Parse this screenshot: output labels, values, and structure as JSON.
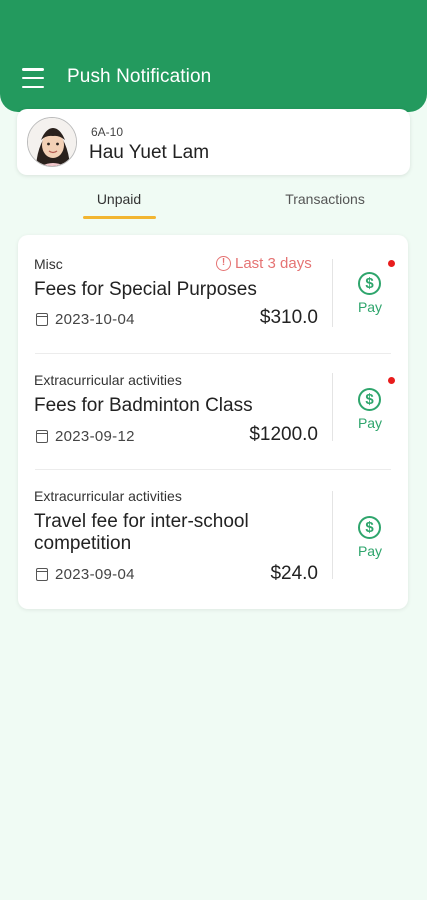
{
  "header": {
    "title": "Push Notification"
  },
  "student": {
    "class_code": "6A-10",
    "name": "Hau Yuet Lam"
  },
  "tabs": [
    {
      "label": "Unpaid",
      "active": true
    },
    {
      "label": "Transactions",
      "active": false
    }
  ],
  "fees": [
    {
      "category": "Misc",
      "title": "Fees for Special Purposes",
      "date": "2023-10-04",
      "amount": "$310.0",
      "warning": "Last 3 days",
      "pay_label": "Pay",
      "unread": true
    },
    {
      "category": "Extracurricular activities",
      "title": "Fees for Badminton Class",
      "date": "2023-09-12",
      "amount": "$1200.0",
      "pay_label": "Pay",
      "unread": true
    },
    {
      "category": "Extracurricular activities",
      "title": "Travel fee for inter-school competition",
      "date": "2023-09-04",
      "amount": "$24.0",
      "pay_label": "Pay",
      "unread": false
    }
  ],
  "colors": {
    "brand_green": "#239a5e",
    "accent_yellow": "#f2b531",
    "warning_red": "#e57373",
    "pay_green": "#2ea56c",
    "unread_dot": "#e81c1c"
  },
  "icons": {
    "menu": "hamburger-menu-icon",
    "date": "calendar-icon",
    "pay": "dollar-circle-icon",
    "warning": "alert-circle-icon"
  }
}
